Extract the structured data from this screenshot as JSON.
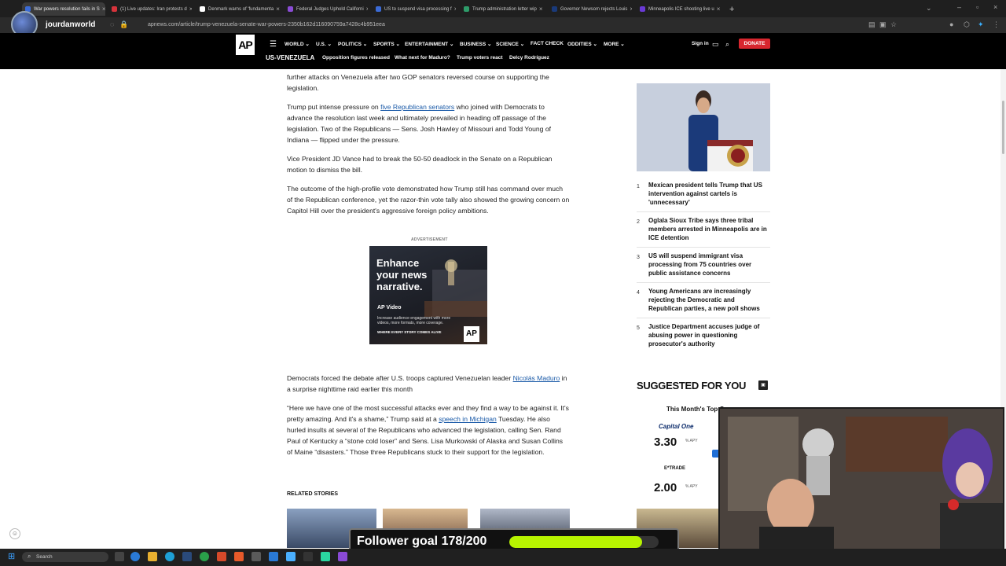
{
  "browser": {
    "tabs": [
      {
        "label": "War powers resolution fails in S",
        "color": "#3b6bd6",
        "active": true
      },
      {
        "label": "(1) Live updates: Iran protests d",
        "color": "#d6333b"
      },
      {
        "label": "Denmark warns of 'fundamenta",
        "color": "#ffffff"
      },
      {
        "label": "Federal Judges Uphold Californi",
        "color": "#8b4cd6"
      },
      {
        "label": "US to suspend visa processing f",
        "color": "#3b6bd6"
      },
      {
        "label": "Trump administration letter wip",
        "color": "#2e9c6a"
      },
      {
        "label": "Governor Newsom rejects Louis",
        "color": "#1a3a7a"
      },
      {
        "label": "Minneapolis ICE shooting live u",
        "color": "#6a3ad6"
      }
    ],
    "new_tab": "+",
    "url": "apnews.com/article/trump-venezuela-senate-war-powers-2350b162d116090759a7428c4b951eea",
    "channel": "jourdanworld"
  },
  "site": {
    "logo": "AP",
    "nav": [
      "WORLD",
      "U.S.",
      "POLITICS",
      "SPORTS",
      "ENTERTAINMENT",
      "BUSINESS",
      "SCIENCE",
      "FACT CHECK",
      "ODDITIES",
      "MORE"
    ],
    "sign_in": "Sign in",
    "donate": "DONATE",
    "section": "US-VENEZUELA",
    "subnav": [
      "Opposition figures released",
      "What next for Maduro?",
      "Trump voters react",
      "Delcy Rodríguez"
    ]
  },
  "article": {
    "p0": "further attacks on Venezuela after two GOP senators reversed course on supporting the legislation.",
    "p1_pre": "Trump put intense pressure on ",
    "p1_link": "five Republican senators",
    "p1_post": " who joined with Democrats to advance the resolution last week and ultimately prevailed in heading off passage of the legislation. Two of the Republicans — Sens. Josh Hawley of Missouri and Todd Young of Indiana — flipped under the pressure.",
    "p2": "Vice President JD Vance had to break the 50-50 deadlock in the Senate on a Republican motion to dismiss the bill.",
    "p3": "The outcome of the high-profile vote demonstrated how Trump still has command over much of the Republican conference, yet the razor-thin vote tally also showed the growing concern on Capitol Hill over the president's aggressive foreign policy ambitions.",
    "ad_label": "ADVERTISEMENT",
    "ad_headline": "Enhance your news narrative.",
    "ad_sub": "AP Video",
    "ad_desc": "Increase audience engagement with more videos, more formats, more coverage.",
    "ad_cta": "WHERE EVERY STORY COMES ALIVE",
    "ad_logo": "AP",
    "p4_pre": "Democrats forced the debate after U.S. troops captured Venezuelan leader ",
    "p4_link": "Nicolás Maduro",
    "p4_post": " in a surprise nighttime raid earlier this month",
    "p5_pre": "“Here we have one of the most successful attacks ever and they find a way to be against it. It's pretty amazing. And it's a shame,” Trump said at a ",
    "p5_link": "speech in Michigan",
    "p5_post": " Tuesday. He also hurled insults at several of the Republicans who advanced the legislation, calling Sen. Rand Paul of Kentucky a “stone cold loser” and Sens. Lisa Murkowski of Alaska and Susan Collins of Maine “disasters.” Those three Republicans stuck to their support for the legislation.",
    "related": "RELATED STORIES"
  },
  "sidebar": {
    "most_read": [
      {
        "num": "1",
        "text": "Mexican president tells Trump that US intervention against cartels is 'unnecessary'"
      },
      {
        "num": "2",
        "text": "Oglala Sioux Tribe says three tribal members arrested in Minneapolis are in ICE detention"
      },
      {
        "num": "3",
        "text": "US will suspend immigrant visa processing from 75 countries over public assistance concerns"
      },
      {
        "num": "4",
        "text": "Young Americans are increasingly rejecting the Democratic and Republican parties, a new poll shows"
      },
      {
        "num": "5",
        "text": "Justice Department accuses judge of abusing power in questioning prosecutor's authority"
      }
    ],
    "suggested": "SUGGESTED FOR YOU",
    "sugg_title": "This Month's Top C",
    "rate1_brand": "Capital One",
    "rate1": "3.30",
    "rate1_unit": "% APY",
    "rate2_brand": "E*TRADE",
    "rate2": "2.00",
    "rate2_unit": "% APY"
  },
  "overlay": {
    "goal_text": "Follower goal 178/200",
    "goal_current": 178,
    "goal_target": 200
  },
  "taskbar": {
    "search": "Search"
  },
  "colors": {
    "ap_red": "#d8262e",
    "link_blue": "#1a5aa8",
    "goal_green": "#b7f300"
  }
}
